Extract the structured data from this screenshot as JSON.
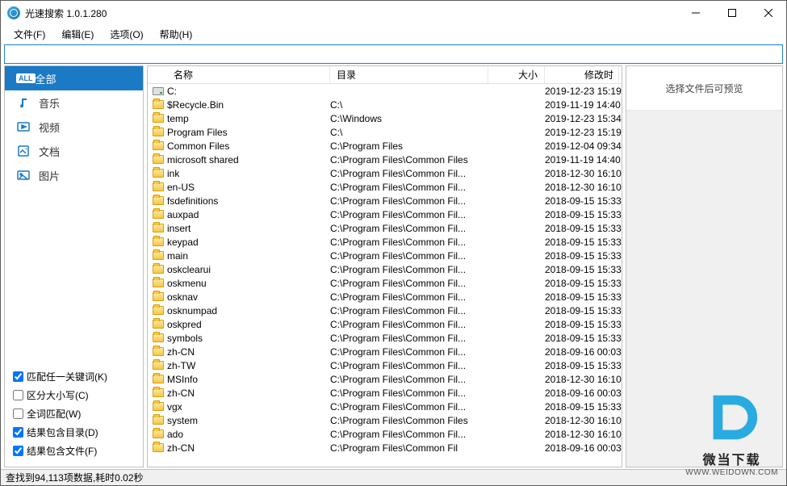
{
  "window": {
    "title": "光速搜索 1.0.1.280"
  },
  "menu": {
    "file": "文件(F)",
    "edit": "编辑(E)",
    "option": "选项(O)",
    "help": "帮助(H)"
  },
  "search": {
    "value": "",
    "placeholder": ""
  },
  "sidebar": {
    "cats": [
      {
        "key": "all",
        "label": "全部",
        "badge": "ALL"
      },
      {
        "key": "music",
        "label": "音乐"
      },
      {
        "key": "video",
        "label": "视频"
      },
      {
        "key": "doc",
        "label": "文档"
      },
      {
        "key": "image",
        "label": "图片"
      }
    ],
    "opts": [
      {
        "key": "anykw",
        "label": "匹配任一关键词(K)",
        "checked": true
      },
      {
        "key": "case",
        "label": "区分大小写(C)",
        "checked": false
      },
      {
        "key": "whole",
        "label": "全词匹配(W)",
        "checked": false
      },
      {
        "key": "incdir",
        "label": "结果包含目录(D)",
        "checked": true
      },
      {
        "key": "incfile",
        "label": "结果包含文件(F)",
        "checked": true
      }
    ]
  },
  "columns": {
    "name": "名称",
    "dir": "目录",
    "size": "大小",
    "mtime": "修改时"
  },
  "files": [
    {
      "icon": "drive",
      "name": "C:",
      "dir": "",
      "mtime": "2019-12-23 15:19:"
    },
    {
      "icon": "folder",
      "name": "$Recycle.Bin",
      "dir": "C:\\",
      "mtime": "2019-11-19 14:40:"
    },
    {
      "icon": "folder",
      "name": "temp",
      "dir": "C:\\Windows",
      "mtime": "2019-12-23 15:34:"
    },
    {
      "icon": "folder",
      "name": "Program Files",
      "dir": "C:\\",
      "mtime": "2019-12-23 15:19:"
    },
    {
      "icon": "folder",
      "name": "Common Files",
      "dir": "C:\\Program Files",
      "mtime": "2019-12-04 09:34:"
    },
    {
      "icon": "folder",
      "name": "microsoft shared",
      "dir": "C:\\Program Files\\Common Files",
      "mtime": "2019-11-19 14:40:"
    },
    {
      "icon": "folder",
      "name": "ink",
      "dir": "C:\\Program Files\\Common Fil...",
      "mtime": "2018-12-30 16:10:"
    },
    {
      "icon": "folder",
      "name": "en-US",
      "dir": "C:\\Program Files\\Common Fil...",
      "mtime": "2018-12-30 16:10:"
    },
    {
      "icon": "folder",
      "name": "fsdefinitions",
      "dir": "C:\\Program Files\\Common Fil...",
      "mtime": "2018-09-15 15:33:"
    },
    {
      "icon": "folder",
      "name": "auxpad",
      "dir": "C:\\Program Files\\Common Fil...",
      "mtime": "2018-09-15 15:33:"
    },
    {
      "icon": "folder",
      "name": "insert",
      "dir": "C:\\Program Files\\Common Fil...",
      "mtime": "2018-09-15 15:33:"
    },
    {
      "icon": "folder",
      "name": "keypad",
      "dir": "C:\\Program Files\\Common Fil...",
      "mtime": "2018-09-15 15:33:"
    },
    {
      "icon": "folder",
      "name": "main",
      "dir": "C:\\Program Files\\Common Fil...",
      "mtime": "2018-09-15 15:33:"
    },
    {
      "icon": "folder",
      "name": "oskclearui",
      "dir": "C:\\Program Files\\Common Fil...",
      "mtime": "2018-09-15 15:33:"
    },
    {
      "icon": "folder",
      "name": "oskmenu",
      "dir": "C:\\Program Files\\Common Fil...",
      "mtime": "2018-09-15 15:33:"
    },
    {
      "icon": "folder",
      "name": "osknav",
      "dir": "C:\\Program Files\\Common Fil...",
      "mtime": "2018-09-15 15:33:"
    },
    {
      "icon": "folder",
      "name": "osknumpad",
      "dir": "C:\\Program Files\\Common Fil...",
      "mtime": "2018-09-15 15:33:"
    },
    {
      "icon": "folder",
      "name": "oskpred",
      "dir": "C:\\Program Files\\Common Fil...",
      "mtime": "2018-09-15 15:33:"
    },
    {
      "icon": "folder",
      "name": "symbols",
      "dir": "C:\\Program Files\\Common Fil...",
      "mtime": "2018-09-15 15:33:"
    },
    {
      "icon": "folder",
      "name": "zh-CN",
      "dir": "C:\\Program Files\\Common Fil...",
      "mtime": "2018-09-16 00:03:"
    },
    {
      "icon": "folder",
      "name": "zh-TW",
      "dir": "C:\\Program Files\\Common Fil...",
      "mtime": "2018-09-15 15:33:"
    },
    {
      "icon": "folder",
      "name": "MSInfo",
      "dir": "C:\\Program Files\\Common Fil...",
      "mtime": "2018-12-30 16:10:"
    },
    {
      "icon": "folder",
      "name": "zh-CN",
      "dir": "C:\\Program Files\\Common Fil...",
      "mtime": "2018-09-16 00:03:"
    },
    {
      "icon": "folder",
      "name": "vgx",
      "dir": "C:\\Program Files\\Common Fil...",
      "mtime": "2018-09-15 15:33:"
    },
    {
      "icon": "folder",
      "name": "system",
      "dir": "C:\\Program Files\\Common Files",
      "mtime": "2018-12-30 16:10:"
    },
    {
      "icon": "folder",
      "name": "ado",
      "dir": "C:\\Program Files\\Common Fil...",
      "mtime": "2018-12-30 16:10:"
    },
    {
      "icon": "folder",
      "name": "zh-CN",
      "dir": "C:\\Program Files\\Common Fil",
      "mtime": "2018-09-16 00:03:"
    }
  ],
  "preview": {
    "hint": "选择文件后可预览"
  },
  "status": {
    "text": "查找到94,113项数据,耗时0.02秒"
  },
  "watermark": {
    "name": "微当下载",
    "url": "WWW.WEIDOWN.COM"
  }
}
